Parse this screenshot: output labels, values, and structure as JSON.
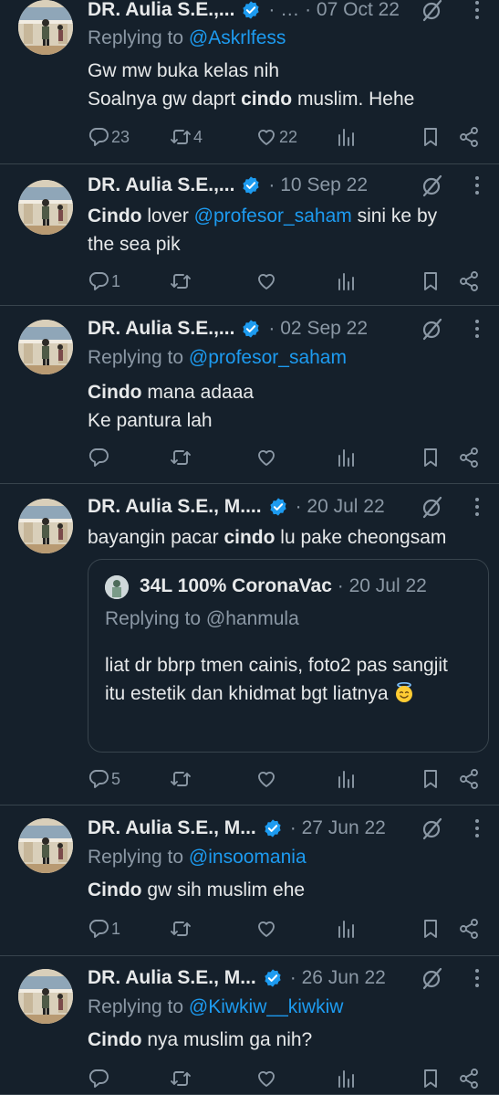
{
  "tweets": [
    {
      "name": "DR. Aulia S.E.,...",
      "meta": "· … · 07 Oct 22",
      "reply_label": "Replying to ",
      "reply_handle": "@Askrlfess",
      "lines": [
        [
          {
            "t": "Gw mw buka kelas nih",
            "b": false
          }
        ],
        [
          {
            "t": "Soalnya gw daprt ",
            "b": false
          },
          {
            "t": "cindo",
            "b": true
          },
          {
            "t": " muslim. Hehe",
            "b": false
          }
        ]
      ],
      "replies": "23",
      "retweets": "4",
      "likes": "22"
    },
    {
      "name": "DR. Aulia S.E.,...",
      "meta": "· 10 Sep 22",
      "reply_label": "",
      "reply_handle": "",
      "lines": [
        [
          {
            "t": "Cindo",
            "b": true
          },
          {
            "t": " lover ",
            "b": false
          },
          {
            "t": "@profesor_saham",
            "b": false,
            "m": true
          },
          {
            "t": " sini ke by",
            "b": false
          }
        ],
        [
          {
            "t": "the sea pik",
            "b": false
          }
        ]
      ],
      "replies": "1",
      "retweets": "",
      "likes": ""
    },
    {
      "name": "DR. Aulia S.E.,...",
      "meta": "· 02 Sep 22",
      "reply_label": "Replying to ",
      "reply_handle": "@profesor_saham",
      "lines": [
        [
          {
            "t": "Cindo",
            "b": true
          },
          {
            "t": " mana adaaa",
            "b": false
          }
        ],
        [
          {
            "t": "Ke pantura lah",
            "b": false
          }
        ]
      ],
      "replies": "",
      "retweets": "",
      "likes": ""
    },
    {
      "name": "DR. Aulia S.E., M....",
      "meta": "· 20 Jul 22",
      "reply_label": "",
      "reply_handle": "",
      "lines": [
        [
          {
            "t": "bayangin pacar ",
            "b": false
          },
          {
            "t": "cindo",
            "b": true
          },
          {
            "t": " lu pake cheongsam",
            "b": false
          }
        ]
      ],
      "quote": {
        "name": "34L 100% CoronaVac",
        "meta": "· 20 Jul 22",
        "reply": "Replying to @hanmula",
        "text": "liat dr bbrp tmen cainis, foto2 pas sangjit itu estetik dan khidmat bgt liatnya"
      },
      "replies": "5",
      "retweets": "",
      "likes": ""
    },
    {
      "name": "DR. Aulia S.E., M...",
      "meta": "· 27 Jun 22",
      "reply_label": "Replying to ",
      "reply_handle": "@insoomania",
      "lines": [
        [
          {
            "t": "Cindo",
            "b": true
          },
          {
            "t": " gw sih muslim ehe",
            "b": false
          }
        ]
      ],
      "replies": "1",
      "retweets": "",
      "likes": ""
    },
    {
      "name": "DR. Aulia S.E., M...",
      "meta": "· 26 Jun 22",
      "reply_label": "Replying to ",
      "reply_handle": "@Kiwkiw__kiwkiw",
      "lines": [
        [
          {
            "t": "Cindo",
            "b": true
          },
          {
            "t": " nya muslim ga nih?",
            "b": false
          }
        ]
      ],
      "replies": "",
      "retweets": "",
      "likes": ""
    }
  ],
  "icons": {
    "reply": "reply-icon",
    "retweet": "retweet-icon",
    "like": "like-icon",
    "views": "views-icon",
    "bookmark": "bookmark-icon",
    "share": "share-icon",
    "verified": "verified-badge-icon",
    "grok": "grok-icon",
    "more": "more-icon"
  },
  "colors": {
    "background": "#15202b",
    "accent": "#1d9bf0",
    "muted": "#8b98a5",
    "text": "#e7e9ea",
    "border": "#38444d"
  }
}
